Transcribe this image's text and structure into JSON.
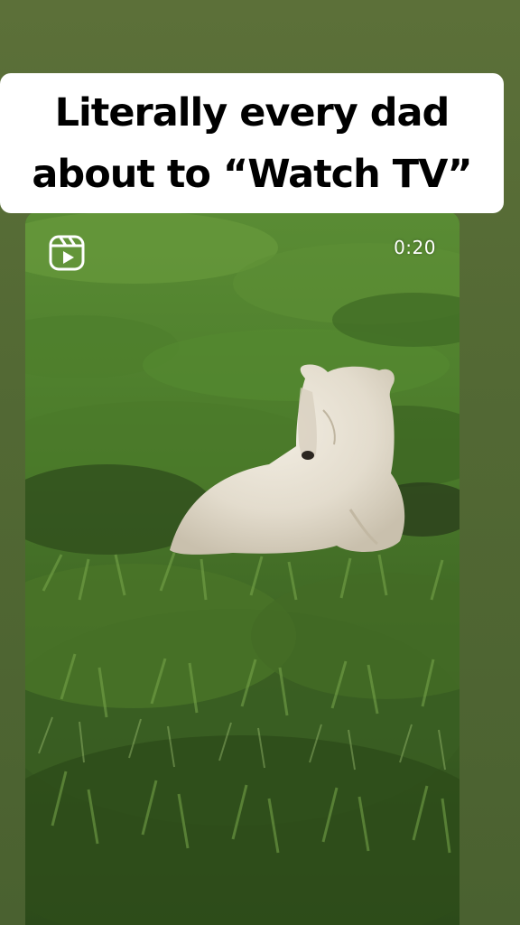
{
  "story": {
    "caption_text": "Literally every dad about to “Watch TV”",
    "background_color": "#536934",
    "caption_bg_color": "#ffffff"
  },
  "video": {
    "duration_label": "0:20",
    "reels_icon": "reels-icon",
    "subject": "polar-bear-in-grass"
  }
}
